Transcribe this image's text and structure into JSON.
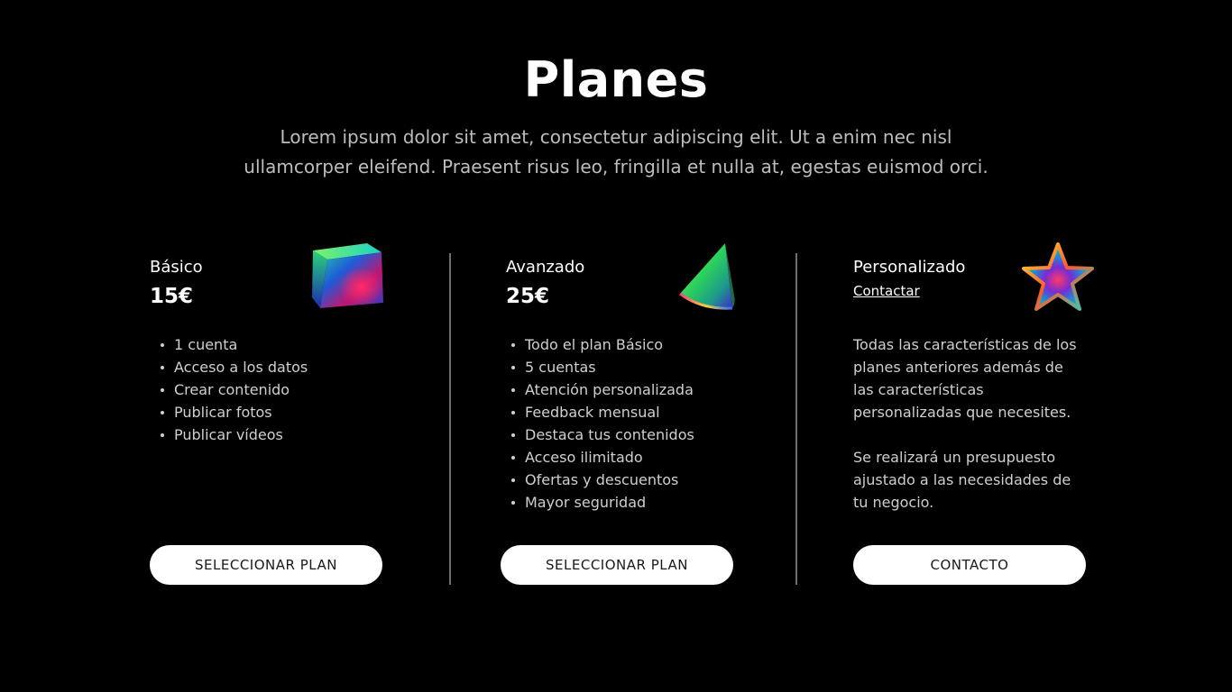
{
  "header": {
    "title": "Planes",
    "subtitle_line1": "Lorem ipsum dolor sit amet, consectetur adipiscing elit. Ut a enim nec nisl",
    "subtitle_line2": "ullamcorper eleifend. Praesent risus leo, fringilla et nulla at, egestas euismod orci."
  },
  "plans": [
    {
      "name": "Básico",
      "price": "15€",
      "icon": "iridescent-cube-icon",
      "features": [
        "1 cuenta",
        "Acceso a los datos",
        "Crear contenido",
        "Publicar fotos",
        "Publicar vídeos"
      ],
      "button_label": "SELECCIONAR PLAN"
    },
    {
      "name": "Avanzado",
      "price": "25€",
      "icon": "iridescent-cone-icon",
      "features": [
        "Todo el plan Básico",
        "5 cuentas",
        "Atención personalizada",
        "Feedback mensual",
        "Destaca tus contenidos",
        "Acceso ilimitado",
        "Ofertas y descuentos",
        "Mayor seguridad"
      ],
      "button_label": "SELECCIONAR PLAN"
    },
    {
      "name": "Personalizado",
      "link_label": "Contactar",
      "icon": "iridescent-star-icon",
      "paragraph1": "Todas las características de los planes anteriores además de las características personalizadas que necesites.",
      "paragraph2": "Se realizará un presupuesto ajustado a las necesidades de tu negocio.",
      "button_label": "CONTACTO"
    }
  ],
  "colors": {
    "background": "#000000",
    "text": "#ffffff",
    "muted_text": "#bdbdbd",
    "button_bg": "#ffffff",
    "button_text": "#1a1a1a",
    "divider": "#6e6e6e"
  }
}
